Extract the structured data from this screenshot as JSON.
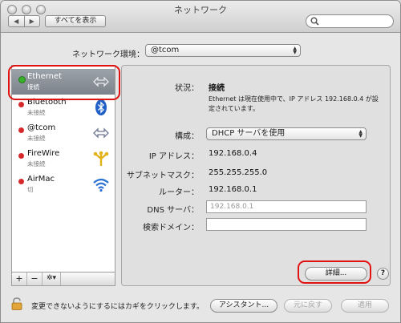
{
  "window": {
    "title": "ネットワーク"
  },
  "toolbar": {
    "show_all_label": "すべてを表示",
    "back_glyph": "◀",
    "forward_glyph": "▶"
  },
  "location": {
    "label": "ネットワーク環境：",
    "value": "@tcom"
  },
  "services": [
    {
      "name": "Ethernet",
      "status": "接続",
      "dot_color": "#37b12b",
      "icon": "ethernet-arrows-icon",
      "selected": true
    },
    {
      "name": "Bluetooth",
      "status": "未接続",
      "dot_color": "#d52a2a",
      "icon": "bluetooth-icon"
    },
    {
      "name": "@tcom",
      "status": "未接続",
      "dot_color": "#d52a2a",
      "icon": "ethernet-arrows-icon"
    },
    {
      "name": "FireWire",
      "status": "未接続",
      "dot_color": "#d52a2a",
      "icon": "firewire-icon"
    },
    {
      "name": "AirMac",
      "status": "切",
      "dot_color": "#d52a2a",
      "icon": "wifi-icon"
    }
  ],
  "list_toolbar": {
    "add": "+",
    "remove": "−",
    "action": "✲▾"
  },
  "detail": {
    "status_label": "状況：",
    "status_value": "接続",
    "status_desc": "Ethernet は現在使用中で、IP アドレス 192.168.0.4 が設定されています。",
    "config_label": "構成：",
    "config_value": "DHCP サーバを使用",
    "ip_label": "IP アドレス：",
    "ip_value": "192.168.0.4",
    "subnet_label": "サブネットマスク：",
    "subnet_value": "255.255.255.0",
    "router_label": "ルーター：",
    "router_value": "192.168.0.1",
    "dns_label": "DNS サーバ：",
    "dns_placeholder": "192.168.0.1",
    "search_domain_label": "検索ドメイン：",
    "search_domain_value": "",
    "advanced_label": "詳細...",
    "help_label": "?"
  },
  "bottom": {
    "lock_text": "変更できないようにするにはカギをクリックします。",
    "assistant_label": "アシスタント...",
    "revert_label": "元に戻す",
    "apply_label": "適用"
  },
  "colors": {
    "highlight_outline": "#e01212",
    "selected_row": "#8a9099"
  }
}
